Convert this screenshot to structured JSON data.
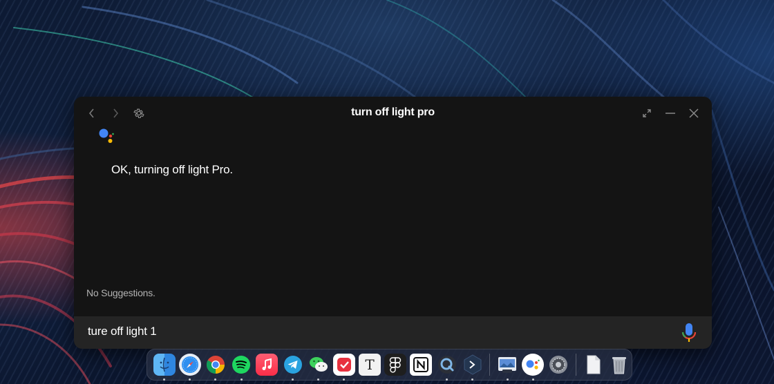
{
  "window": {
    "title": "turn off light pro",
    "response": "OK, turning off light Pro.",
    "suggestions_status": "No Suggestions.",
    "input_value": "ture off light 1"
  },
  "icons": {
    "back": "chevron-left-icon",
    "forward": "chevron-right-icon",
    "settings": "gear-icon",
    "expand": "expand-icon",
    "minimize": "minimize-icon",
    "close": "close-icon",
    "assistant": "google-assistant-icon",
    "mic": "microphone-icon"
  },
  "dock": {
    "apps": [
      {
        "name": "Finder",
        "icon": "finder-icon",
        "running": true
      },
      {
        "name": "Safari",
        "icon": "safari-icon",
        "running": true
      },
      {
        "name": "Chrome",
        "icon": "chrome-icon",
        "running": true
      },
      {
        "name": "Spotify",
        "icon": "spotify-icon",
        "running": true
      },
      {
        "name": "Music",
        "icon": "music-icon",
        "running": false
      },
      {
        "name": "Telegram",
        "icon": "telegram-icon",
        "running": true
      },
      {
        "name": "WeChat",
        "icon": "wechat-icon",
        "running": true
      },
      {
        "name": "Tasks",
        "icon": "tasks-icon",
        "running": true
      },
      {
        "name": "Typora",
        "icon": "typora-icon",
        "running": false
      },
      {
        "name": "Figma",
        "icon": "figma-icon",
        "running": false
      },
      {
        "name": "Notion",
        "icon": "notion-icon",
        "running": false
      },
      {
        "name": "QuickTime",
        "icon": "quicktime-icon",
        "running": true
      },
      {
        "name": "Terminal",
        "icon": "terminal-icon",
        "running": true
      },
      {
        "name": "Preview",
        "icon": "preview-icon",
        "running": true
      },
      {
        "name": "Google Assistant",
        "icon": "google-assistant-icon",
        "running": true
      },
      {
        "name": "System Preferences",
        "icon": "system-preferences-icon",
        "running": false
      },
      {
        "name": "Document",
        "icon": "document-icon",
        "running": false
      },
      {
        "name": "Trash",
        "icon": "trash-icon",
        "running": false
      }
    ]
  },
  "colors": {
    "window_bg": "#141414",
    "input_bar_bg": "#242424",
    "google_blue": "#4285F4",
    "google_red": "#EA4335",
    "google_yellow": "#FBBC05",
    "google_green": "#34A853"
  }
}
